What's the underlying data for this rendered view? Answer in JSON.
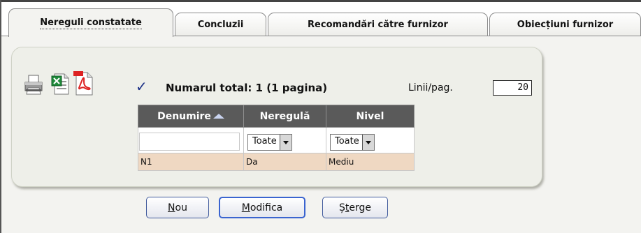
{
  "tabs": [
    {
      "label": "Nereguli constatate",
      "active": true
    },
    {
      "label": "Concluzii",
      "active": false
    },
    {
      "label": "Recomandări către furnizor",
      "active": false
    },
    {
      "label": "Obiecțiuni furnizor",
      "active": false
    }
  ],
  "toolbar": {
    "icons": [
      "printer-icon",
      "excel-icon",
      "pdf-icon"
    ]
  },
  "summary": {
    "check_symbol": "✓",
    "total_text": "Numarul total: 1 (1 pagina)",
    "rows_per_page_label": "Linii/pag.",
    "rows_per_page_value": "20"
  },
  "grid": {
    "columns": [
      "Denumire",
      "Neregulă",
      "Nivel"
    ],
    "sorted_column": "Denumire",
    "filters": {
      "denumire": "",
      "neregula": "Toate",
      "nivel": "Toate"
    },
    "rows": [
      {
        "denumire": "N1",
        "neregula": "Da",
        "nivel": "Mediu"
      }
    ]
  },
  "actions": {
    "new": {
      "mnemonic": "N",
      "rest": "ou"
    },
    "edit": {
      "mnemonic": "M",
      "rest": "odifica"
    },
    "delete": {
      "prefix": "Ș",
      "mnemonic": "t",
      "rest": "erge"
    }
  },
  "colors": {
    "header_bg": "#5a5a5a",
    "row_bg": "#efd8c2",
    "check": "#1a2f86",
    "button_border": "#405a9c"
  }
}
